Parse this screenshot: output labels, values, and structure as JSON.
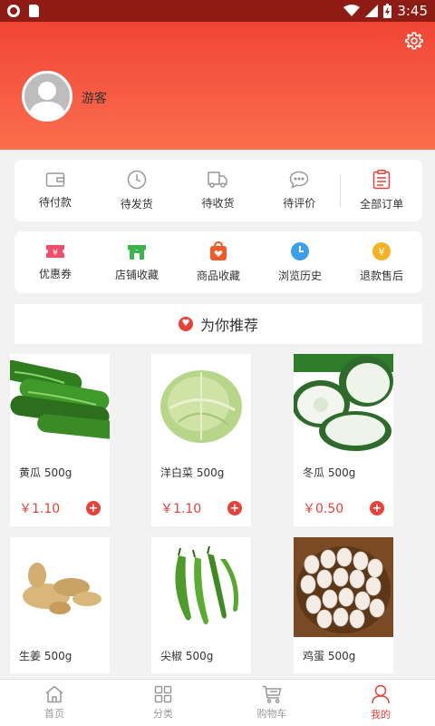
{
  "status": {
    "time": "3:45"
  },
  "user": {
    "name": "游客"
  },
  "orders": [
    {
      "label": "待付款",
      "icon": "wallet-icon"
    },
    {
      "label": "待发货",
      "icon": "clock-icon"
    },
    {
      "label": "待收货",
      "icon": "truck-icon"
    },
    {
      "label": "待评价",
      "icon": "comment-icon"
    },
    {
      "label": "全部订单",
      "icon": "order-list-icon"
    }
  ],
  "services": [
    {
      "label": "优惠券",
      "icon": "coupon-icon",
      "color": "#ef4f6a"
    },
    {
      "label": "店铺收藏",
      "icon": "shop-icon",
      "color": "#39b54a"
    },
    {
      "label": "商品收藏",
      "icon": "bag-heart-icon",
      "color": "#f05a28"
    },
    {
      "label": "浏览历史",
      "icon": "history-clock-icon",
      "color": "#3aa0e8"
    },
    {
      "label": "退款售后",
      "icon": "refund-icon",
      "color": "#f5b324"
    }
  ],
  "recommend": {
    "title": "为你推荐"
  },
  "products": [
    {
      "name": "黄瓜 500g",
      "price": "￥1.10",
      "image": "cucumber"
    },
    {
      "name": "洋白菜 500g",
      "price": "￥1.10",
      "image": "cabbage"
    },
    {
      "name": "冬瓜 500g",
      "price": "￥0.50",
      "image": "wax-gourd"
    },
    {
      "name": "生姜 500g",
      "price": "",
      "image": "ginger"
    },
    {
      "name": "尖椒 500g",
      "price": "",
      "image": "green-pepper"
    },
    {
      "name": "鸡蛋 500g",
      "price": "",
      "image": "eggs"
    }
  ],
  "nav": [
    {
      "label": "首页",
      "icon": "home-icon"
    },
    {
      "label": "分类",
      "icon": "category-grid-icon"
    },
    {
      "label": "购物车",
      "icon": "cart-icon"
    },
    {
      "label": "我的",
      "icon": "profile-icon",
      "active": true
    }
  ],
  "colors": {
    "brand": "#f04536",
    "price": "#e8413a"
  }
}
